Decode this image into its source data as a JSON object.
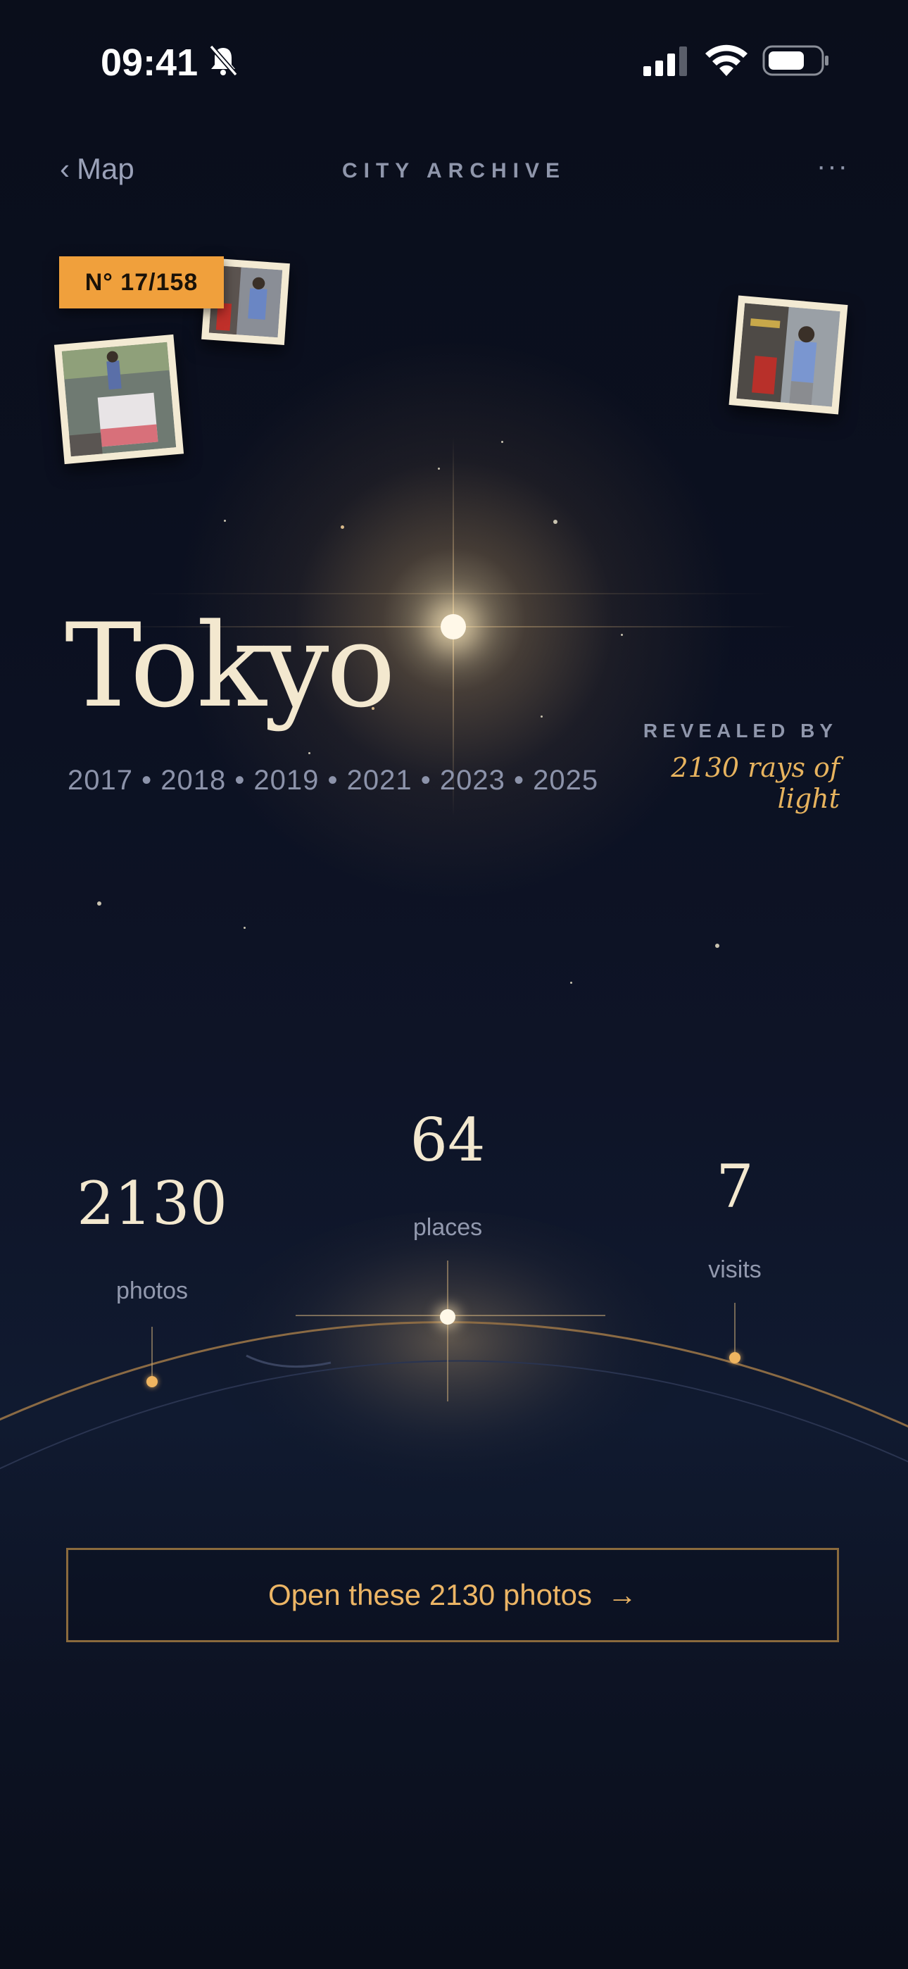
{
  "status_bar": {
    "time": "09:41"
  },
  "nav": {
    "back_label": "Map",
    "title": "CITY ARCHIVE",
    "more_label": "···"
  },
  "badge": "N° 17/158",
  "hero": {
    "city": "Tokyo",
    "years": "2017 • 2018 • 2019 • 2021 • 2023 • 2025",
    "revealed_label": "REVEALED BY",
    "revealed_value": "2130 rays of light"
  },
  "stats": {
    "photos": {
      "value": "2130",
      "label": "photos"
    },
    "places": {
      "value": "64",
      "label": "places"
    },
    "visits": {
      "value": "7",
      "label": "visits"
    }
  },
  "cta": {
    "label": "Open these 2130 photos",
    "arrow": "→"
  },
  "colors": {
    "accent": "#f0a03c",
    "gold_text": "#ecb565",
    "background": "#0b1020"
  }
}
